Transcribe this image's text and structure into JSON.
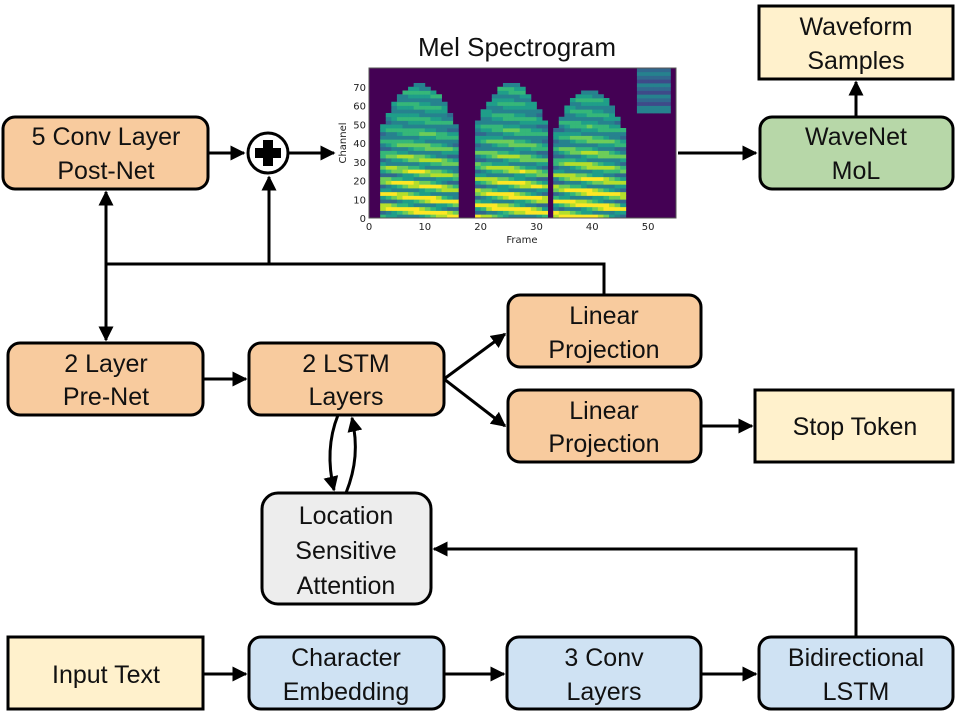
{
  "colors": {
    "orange": "#F8CB9E",
    "green": "#B7D7A8",
    "cream": "#FFF1CC",
    "blue": "#CFE2F3",
    "grey": "#EDEDED",
    "viridis": [
      "#440154",
      "#482878",
      "#3E4A89",
      "#31688E",
      "#26828E",
      "#1F9E89",
      "#35B779",
      "#6DCD59",
      "#B4DE2C",
      "#FDE725"
    ]
  },
  "nodes": {
    "postnet": {
      "line1": "5 Conv Layer",
      "line2": "Post-Net"
    },
    "wavenet": {
      "line1": "WaveNet",
      "line2": "MoL"
    },
    "waveform": {
      "line1": "Waveform",
      "line2": "Samples"
    },
    "prenet": {
      "line1": "2 Layer",
      "line2": "Pre-Net"
    },
    "lstm": {
      "line1": "2 LSTM",
      "line2": "Layers"
    },
    "linear1": {
      "line1": "Linear",
      "line2": "Projection"
    },
    "linear2": {
      "line1": "Linear",
      "line2": "Projection"
    },
    "stop": {
      "line1": "Stop Token"
    },
    "attention": {
      "line1": "Location",
      "line2": "Sensitive",
      "line3": "Attention"
    },
    "input": {
      "line1": "Input Text"
    },
    "charemb": {
      "line1": "Character",
      "line2": "Embedding"
    },
    "conv3": {
      "line1": "3 Conv",
      "line2": "Layers"
    },
    "bilstm": {
      "line1": "Bidirectional",
      "line2": "LSTM"
    }
  },
  "plus_icon": "plus-circle-icon",
  "spectrogram": {
    "title": "Mel Spectrogram",
    "xlabel": "Frame",
    "ylabel": "Channel",
    "xlim": [
      0,
      55
    ],
    "ylim": [
      0,
      80
    ],
    "xticks": [
      "0",
      "10",
      "20",
      "30",
      "40",
      "50"
    ],
    "yticks": [
      "0",
      "10",
      "20",
      "30",
      "40",
      "50",
      "60",
      "70"
    ]
  }
}
